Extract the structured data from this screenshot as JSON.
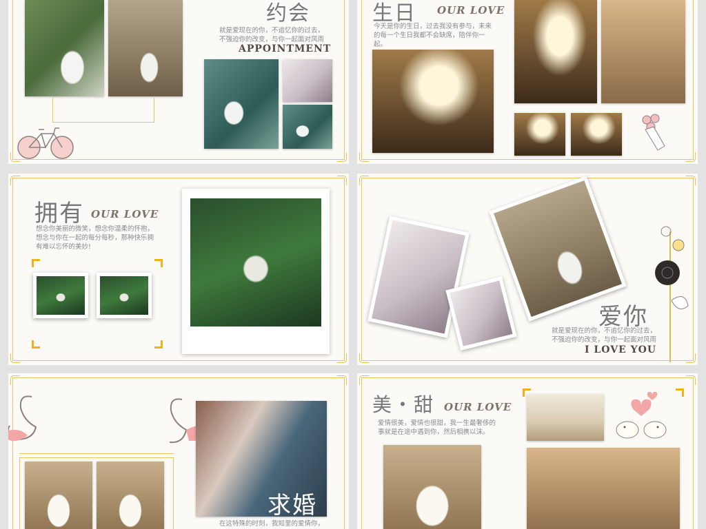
{
  "slides": {
    "yuehui": {
      "title_cn": "约会",
      "body": "就是爱现在的你，不追忆你的过去，\n不强迫你的改变，与你一起面对风雨",
      "title_en": "APPOINTMENT",
      "caption": ""
    },
    "shengri": {
      "title_cn": "生日",
      "title_en": "OUR LOVE",
      "body": "今天是你的生日，过去我没有参与，未来\n的每一个生日我都不会缺席，陪伴你一\n起。"
    },
    "yongyou": {
      "title_cn": "拥有",
      "title_en": "OUR LOVE",
      "body": "想念你美丽的微笑，想念你温柔的怀抱，\n想念与你在一起的每分每秒，那种快乐拥\n有难以忘怀的美妙!",
      "caption_left": "",
      "caption_right": ""
    },
    "aini": {
      "title_cn": "爱你",
      "body": "就是爱现在的你，不追忆你的过去，\n不强迫你的改变，与你一起面对风雨",
      "title_en": "I LOVE YOU"
    },
    "qiuhun": {
      "title_cn": "求婚",
      "body": "在这特殊的时刻，我知里的爱情你，"
    },
    "meitian": {
      "title_cn": "美・甜",
      "title_en": "OUR LOVE",
      "body": "爱情很美，爱情也很甜，我一生最奢侈的\n事就是在途中遇到你，然后相携以沫。"
    }
  },
  "colors": {
    "gold": "#e9c45b",
    "accent": "#efb21c",
    "pink": "#f2a6a6"
  }
}
